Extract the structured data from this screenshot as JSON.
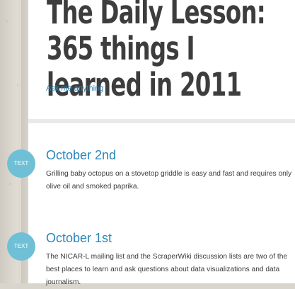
{
  "blog": {
    "title": "The Daily Lesson: 365 things I learned in 2011",
    "ask_link": "Ask me anything"
  },
  "posts": [
    {
      "type_badge": "TEXT",
      "title": "October 2nd",
      "body": "Grilling baby octopus on a stovetop griddle is easy and fast and requires only olive oil and smoked paprika."
    },
    {
      "type_badge": "TEXT",
      "title": "October 1st",
      "body": "The NICAR-L mailing list and the ScraperWiki discussion lists are two of the best places to learn and ask questions about data visualizations and data journalism."
    }
  ],
  "colors": {
    "link": "#2a86b8",
    "badge": "#6fc0d6",
    "title_text": "#3d3d3d"
  }
}
